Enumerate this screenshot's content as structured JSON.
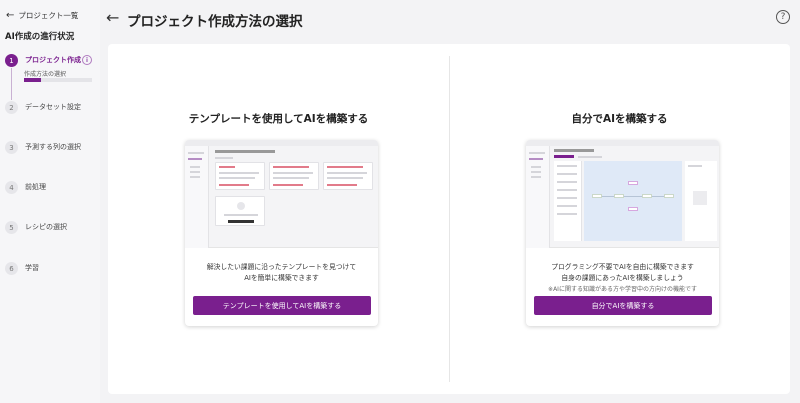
{
  "sidebar": {
    "back_label": "プロジェクト一覧",
    "title": "AI作成の進行状況",
    "steps": [
      {
        "num": "1",
        "label": "プロジェクト作成"
      },
      {
        "num": "2",
        "label": "データセット設定"
      },
      {
        "num": "3",
        "label": "予測する列の選択"
      },
      {
        "num": "4",
        "label": "前処理"
      },
      {
        "num": "5",
        "label": "レシピの選択"
      },
      {
        "num": "6",
        "label": "学習"
      }
    ],
    "sub_step_label": "作成方法の選択",
    "progress_fraction": 0.25,
    "info_glyph": "i"
  },
  "header": {
    "title": "プロジェクト作成方法の選択",
    "back_glyph": "←",
    "help_glyph": "?"
  },
  "options": {
    "template": {
      "title": "テンプレートを使用してAIを構築する",
      "desc_line1": "解決したい課題に沿ったテンプレートを見つけて",
      "desc_line2": "AIを簡単に構築できます",
      "button": "テンプレートを使用してAIを構築する"
    },
    "custom": {
      "title": "自分でAIを構築する",
      "desc_line1": "プログラミング不要でAIを自由に構築できます",
      "desc_line2": "自身の課題にあったAIを構築しましょう",
      "note": "※AIに関する知識がある方や学習中の方向けの機能です",
      "button": "自分でAIを構築する"
    }
  },
  "colors": {
    "accent": "#7a1f8e"
  }
}
